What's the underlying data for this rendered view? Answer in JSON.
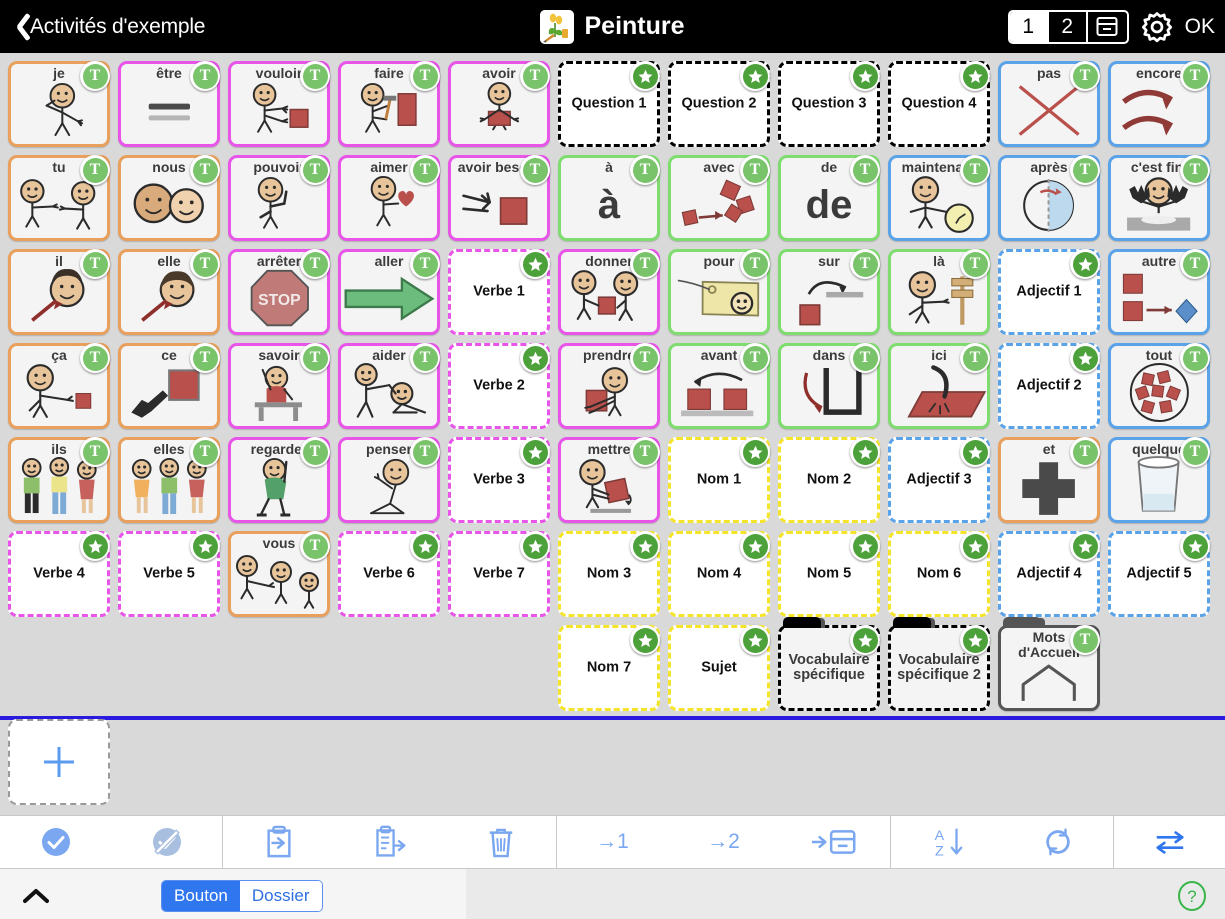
{
  "header": {
    "back_label": "Activités d'exemple",
    "title": "Peinture",
    "title_icon": "painting-icon",
    "page_1": "1",
    "page_2": "2",
    "archive_icon": "archive-box-icon",
    "settings_icon": "gear-icon",
    "ok_label": "OK",
    "active_page": "1"
  },
  "colors": {
    "orange": "#e8a05c",
    "magenta": "#e855e8",
    "green": "#7fdd6f",
    "blue": "#5ba3e8",
    "yellow": "#f5e52a",
    "black": "#000000",
    "accent_blue": "#2f76ef",
    "badge_green": "#79c36a",
    "star_green": "#4da13a"
  },
  "grid": {
    "columns": 11,
    "rows": [
      [
        {
          "label": "je",
          "border": "orange",
          "style": "solid",
          "badge": "T",
          "pict": "person-point-self"
        },
        {
          "label": "être",
          "border": "magenta",
          "style": "solid",
          "badge": "T",
          "pict": "equals-bars"
        },
        {
          "label": "vouloir",
          "border": "magenta",
          "style": "solid",
          "badge": "T",
          "pict": "person-reach-block"
        },
        {
          "label": "faire",
          "border": "magenta",
          "style": "solid",
          "badge": "T",
          "pict": "person-hammer"
        },
        {
          "label": "avoir",
          "border": "magenta",
          "style": "solid",
          "badge": "T",
          "pict": "person-hold-block"
        },
        {
          "label": "Question 1",
          "border": "black",
          "style": "dashed",
          "badge": "star",
          "pict": "none"
        },
        {
          "label": "Question 2",
          "border": "black",
          "style": "dashed",
          "badge": "star",
          "pict": "none"
        },
        {
          "label": "Question 3",
          "border": "black",
          "style": "dashed",
          "badge": "star",
          "pict": "none"
        },
        {
          "label": "Question 4",
          "border": "black",
          "style": "dashed",
          "badge": "star",
          "pict": "none"
        },
        {
          "label": "pas",
          "border": "blue",
          "style": "solid",
          "badge": "T",
          "pict": "red-cross-x"
        },
        {
          "label": "encore",
          "border": "blue",
          "style": "solid",
          "badge": "T",
          "pict": "two-curved-arrows"
        }
      ],
      [
        {
          "label": "tu",
          "border": "orange",
          "style": "solid",
          "badge": "T",
          "pict": "two-persons-point"
        },
        {
          "label": "nous",
          "border": "orange",
          "style": "solid",
          "badge": "T",
          "pict": "two-heads"
        },
        {
          "label": "pouvoir",
          "border": "magenta",
          "style": "solid",
          "badge": "T",
          "pict": "person-flex"
        },
        {
          "label": "aimer",
          "border": "magenta",
          "style": "solid",
          "badge": "T",
          "pict": "person-heart"
        },
        {
          "label": "avoir besoin",
          "border": "magenta",
          "style": "solid",
          "badge": "T",
          "pict": "hand-reach-block"
        },
        {
          "label": "à",
          "border": "green",
          "style": "solid",
          "badge": "T",
          "pict": "glyph",
          "glyph": "à"
        },
        {
          "label": "avec",
          "border": "green",
          "style": "solid",
          "badge": "T",
          "pict": "blocks-arrow"
        },
        {
          "label": "de",
          "border": "green",
          "style": "solid",
          "badge": "T",
          "pict": "glyph",
          "glyph": "de"
        },
        {
          "label": "maintenant",
          "border": "blue",
          "style": "solid",
          "badge": "T",
          "pict": "person-clock"
        },
        {
          "label": "après",
          "border": "blue",
          "style": "solid",
          "badge": "T",
          "pict": "circle-half-arrow"
        },
        {
          "label": "c'est fini",
          "border": "blue",
          "style": "solid",
          "badge": "T",
          "pict": "person-hands-table"
        }
      ],
      [
        {
          "label": "il",
          "border": "orange",
          "style": "solid",
          "badge": "T",
          "pict": "head-arrow-male"
        },
        {
          "label": "elle",
          "border": "orange",
          "style": "solid",
          "badge": "T",
          "pict": "head-arrow-female"
        },
        {
          "label": "arrêter",
          "border": "magenta",
          "style": "solid",
          "badge": "T",
          "pict": "stop-sign"
        },
        {
          "label": "aller",
          "border": "magenta",
          "style": "solid",
          "badge": "T",
          "pict": "green-arrow-right"
        },
        {
          "label": "Verbe 1",
          "border": "magenta",
          "style": "dashed",
          "badge": "star",
          "pict": "none"
        },
        {
          "label": "donner",
          "border": "magenta",
          "style": "solid",
          "badge": "T",
          "pict": "two-persons-give"
        },
        {
          "label": "pour",
          "border": "green",
          "style": "solid",
          "badge": "T",
          "pict": "gift-tag"
        },
        {
          "label": "sur",
          "border": "green",
          "style": "solid",
          "badge": "T",
          "pict": "block-onto-line"
        },
        {
          "label": "là",
          "border": "green",
          "style": "solid",
          "badge": "T",
          "pict": "person-point-sign"
        },
        {
          "label": "Adjectif 1",
          "border": "blue",
          "style": "dashed",
          "badge": "star",
          "pict": "none"
        },
        {
          "label": "autre",
          "border": "blue",
          "style": "solid",
          "badge": "T",
          "pict": "shapes-other"
        }
      ],
      [
        {
          "label": "ça",
          "border": "orange",
          "style": "solid",
          "badge": "T",
          "pict": "person-point-block"
        },
        {
          "label": "ce",
          "border": "orange",
          "style": "solid",
          "badge": "T",
          "pict": "hand-point-block"
        },
        {
          "label": "savoir",
          "border": "magenta",
          "style": "solid",
          "badge": "T",
          "pict": "person-raise-hand-desk"
        },
        {
          "label": "aider",
          "border": "magenta",
          "style": "solid",
          "badge": "T",
          "pict": "person-help-person"
        },
        {
          "label": "Verbe 2",
          "border": "magenta",
          "style": "dashed",
          "badge": "star",
          "pict": "none"
        },
        {
          "label": "prendre",
          "border": "magenta",
          "style": "solid",
          "badge": "T",
          "pict": "person-take-block"
        },
        {
          "label": "avant",
          "border": "green",
          "style": "solid",
          "badge": "T",
          "pict": "two-blocks-arrow-back"
        },
        {
          "label": "dans",
          "border": "green",
          "style": "solid",
          "badge": "T",
          "pict": "arrow-into-container"
        },
        {
          "label": "ici",
          "border": "green",
          "style": "solid",
          "badge": "T",
          "pict": "point-at-surface"
        },
        {
          "label": "Adjectif 2",
          "border": "blue",
          "style": "dashed",
          "badge": "star",
          "pict": "none"
        },
        {
          "label": "tout",
          "border": "blue",
          "style": "solid",
          "badge": "T",
          "pict": "pile-of-blocks"
        }
      ],
      [
        {
          "label": "ils",
          "border": "orange",
          "style": "solid",
          "badge": "T",
          "pict": "three-people-men"
        },
        {
          "label": "elles",
          "border": "orange",
          "style": "solid",
          "badge": "T",
          "pict": "three-people-women"
        },
        {
          "label": "regarder",
          "border": "magenta",
          "style": "solid",
          "badge": "T",
          "pict": "person-looking"
        },
        {
          "label": "penser",
          "border": "magenta",
          "style": "solid",
          "badge": "T",
          "pict": "person-thinking"
        },
        {
          "label": "Verbe 3",
          "border": "magenta",
          "style": "dashed",
          "badge": "star",
          "pict": "none"
        },
        {
          "label": "mettre",
          "border": "magenta",
          "style": "solid",
          "badge": "T",
          "pict": "person-put-block"
        },
        {
          "label": "Nom 1",
          "border": "yellow",
          "style": "dashed",
          "badge": "star",
          "pict": "none"
        },
        {
          "label": "Nom 2",
          "border": "yellow",
          "style": "dashed",
          "badge": "star",
          "pict": "none"
        },
        {
          "label": "Adjectif 3",
          "border": "blue",
          "style": "dashed",
          "badge": "star",
          "pict": "none"
        },
        {
          "label": "et",
          "border": "orange",
          "style": "solid",
          "badge": "T",
          "pict": "plus-sign"
        },
        {
          "label": "quelque",
          "border": "blue",
          "style": "solid",
          "badge": "T",
          "pict": "glass-water"
        }
      ],
      [
        {
          "label": "Verbe 4",
          "border": "magenta",
          "style": "dashed",
          "badge": "star",
          "pict": "none"
        },
        {
          "label": "Verbe 5",
          "border": "magenta",
          "style": "dashed",
          "badge": "star",
          "pict": "none"
        },
        {
          "label": "vous",
          "border": "orange",
          "style": "solid",
          "badge": "T",
          "pict": "person-point-group"
        },
        {
          "label": "Verbe 6",
          "border": "magenta",
          "style": "dashed",
          "badge": "star",
          "pict": "none"
        },
        {
          "label": "Verbe 7",
          "border": "magenta",
          "style": "dashed",
          "badge": "star",
          "pict": "none"
        },
        {
          "label": "Nom 3",
          "border": "yellow",
          "style": "dashed",
          "badge": "star",
          "pict": "none"
        },
        {
          "label": "Nom 4",
          "border": "yellow",
          "style": "dashed",
          "badge": "star",
          "pict": "none"
        },
        {
          "label": "Nom 5",
          "border": "yellow",
          "style": "dashed",
          "badge": "star",
          "pict": "none"
        },
        {
          "label": "Nom 6",
          "border": "yellow",
          "style": "dashed",
          "badge": "star",
          "pict": "none"
        },
        {
          "label": "Adjectif 4",
          "border": "blue",
          "style": "dashed",
          "badge": "star",
          "pict": "none"
        },
        {
          "label": "Adjectif 5",
          "border": "blue",
          "style": "dashed",
          "badge": "star",
          "pict": "none"
        }
      ],
      [
        {
          "label": "",
          "border": "none",
          "style": "none",
          "badge": "none",
          "pict": "none",
          "blank": true
        },
        {
          "label": "",
          "border": "none",
          "style": "none",
          "badge": "none",
          "pict": "none",
          "blank": true
        },
        {
          "label": "",
          "border": "none",
          "style": "none",
          "badge": "none",
          "pict": "none",
          "blank": true
        },
        {
          "label": "",
          "border": "none",
          "style": "none",
          "badge": "none",
          "pict": "none",
          "blank": true
        },
        {
          "label": "",
          "border": "none",
          "style": "none",
          "badge": "none",
          "pict": "none",
          "blank": true
        },
        {
          "label": "Nom 7",
          "border": "yellow",
          "style": "dashed",
          "badge": "star",
          "pict": "none"
        },
        {
          "label": "Sujet",
          "border": "yellow",
          "style": "dashed",
          "badge": "star",
          "pict": "none"
        },
        {
          "label": "Vocabulaire spécifique",
          "border": "black",
          "style": "dashed",
          "badge": "star",
          "pict": "none",
          "folder": true
        },
        {
          "label": "Vocabulaire spécifique 2",
          "border": "black",
          "style": "dashed",
          "badge": "star",
          "pict": "none",
          "folder": true
        },
        {
          "label": "Mots d'Accueil",
          "border": "darkgrey",
          "style": "solid",
          "badge": "T",
          "pict": "home-outline",
          "folder": true
        }
      ]
    ],
    "add_button": {
      "icon": "plus-icon",
      "label": ""
    }
  },
  "toolbar": {
    "groups": [
      [
        {
          "name": "select-all",
          "icon": "check-circle-icon",
          "label": ""
        },
        {
          "name": "deselect-all",
          "icon": "check-circle-slash-icon",
          "label": ""
        }
      ],
      [
        {
          "name": "import",
          "icon": "clipboard-in-icon",
          "label": ""
        },
        {
          "name": "export",
          "icon": "clipboard-out-icon",
          "label": ""
        },
        {
          "name": "delete",
          "icon": "trash-icon",
          "label": ""
        }
      ],
      [
        {
          "name": "move-to-page-1",
          "icon": "arrow-to-1",
          "label": "→1"
        },
        {
          "name": "move-to-page-2",
          "icon": "arrow-to-2",
          "label": "→2"
        },
        {
          "name": "move-to-archive",
          "icon": "arrow-to-archive",
          "label": ""
        }
      ],
      [
        {
          "name": "sort-alphabetical",
          "icon": "sort-az-icon",
          "label": ""
        },
        {
          "name": "refresh",
          "icon": "refresh-icon",
          "label": ""
        }
      ],
      [
        {
          "name": "swap",
          "icon": "swap-arrows-icon",
          "label": ""
        }
      ]
    ]
  },
  "bottombar": {
    "collapse_icon": "chevron-up-icon",
    "segmented": {
      "options": [
        "Bouton",
        "Dossier"
      ],
      "selected": "Bouton"
    },
    "help_icon": "help-circle-icon"
  }
}
